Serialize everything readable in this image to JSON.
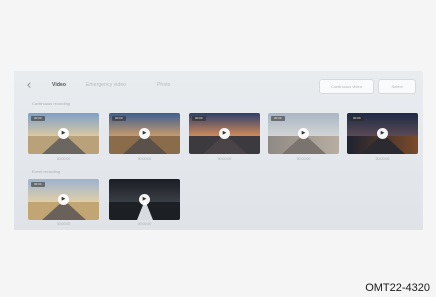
{
  "top": {
    "back_icon": "chevron-left-icon",
    "tabs": [
      {
        "label": "Video",
        "active": true
      },
      {
        "label": "Emergency video",
        "active": false
      },
      {
        "label": "Photo",
        "active": false
      }
    ],
    "buttons": [
      {
        "label": "Continuous video"
      },
      {
        "label": "Select"
      }
    ]
  },
  "sections": [
    {
      "label": "Continuous recording",
      "items": [
        {
          "badge": "00:00",
          "caption": "00:00:00",
          "icon": "play-icon"
        },
        {
          "badge": "00:00",
          "caption": "00:00:00",
          "icon": "play-icon"
        },
        {
          "badge": "00:00",
          "caption": "00:00:00",
          "icon": "play-icon"
        },
        {
          "badge": "00:00",
          "caption": "00:00:00",
          "icon": "play-icon"
        },
        {
          "badge": "00:00",
          "caption": "00:00:00",
          "icon": "play-icon"
        }
      ]
    },
    {
      "label": "Event recording",
      "items": [
        {
          "badge": "00:00",
          "caption": "00:00:00",
          "icon": "play-icon"
        },
        {
          "badge": "",
          "caption": "00:00:00",
          "icon": "play-icon"
        }
      ]
    }
  ],
  "figure_code": "OMT22-4320"
}
